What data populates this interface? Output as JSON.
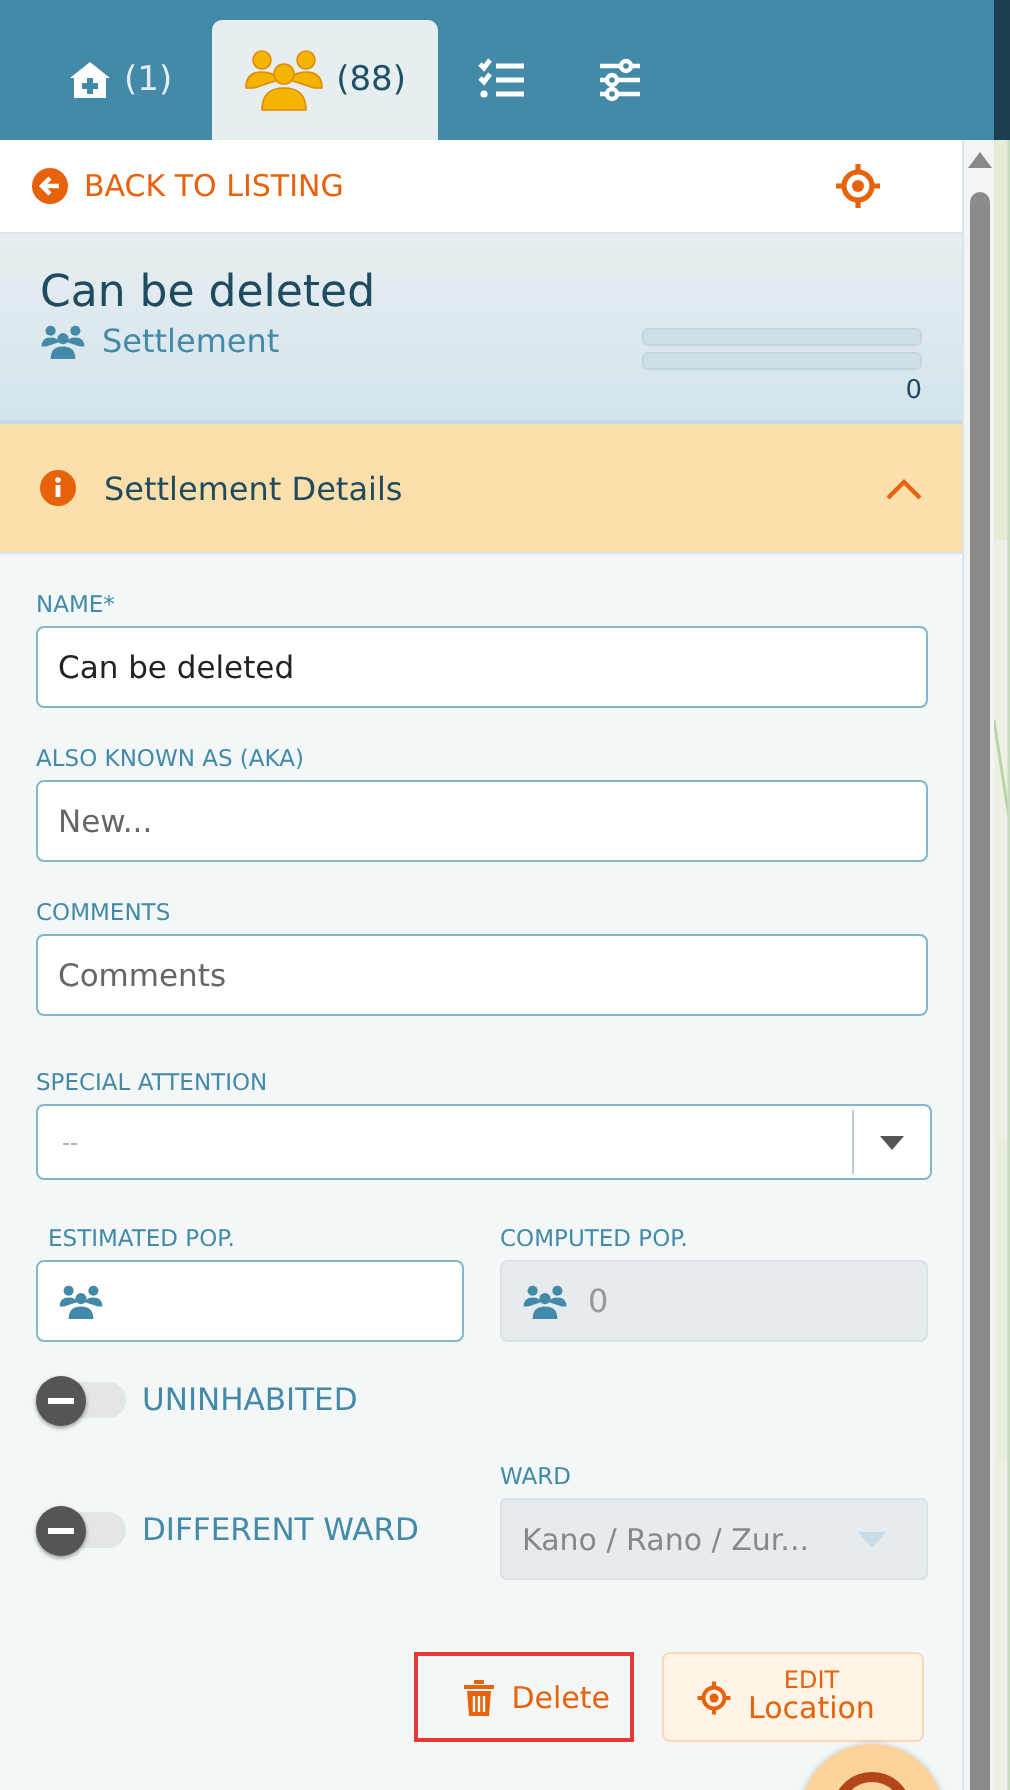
{
  "tabs": [
    {
      "kind": "home",
      "label": "(1)",
      "selected": false
    },
    {
      "kind": "people",
      "label": "(88)",
      "selected": true
    },
    {
      "kind": "checklist",
      "selected": false
    },
    {
      "kind": "filters",
      "selected": false
    }
  ],
  "back_link": "BACK TO LISTING",
  "header": {
    "title": "Can be deleted",
    "type": "Settlement",
    "bars": [
      {
        "level": 0
      },
      {
        "level": 0
      }
    ],
    "count": "0"
  },
  "section": {
    "title": "Settlement Details",
    "expanded": true
  },
  "fields": [
    {
      "kind": "text",
      "label": "NAME*",
      "value": "Can be deleted"
    },
    {
      "kind": "text",
      "label": "ALSO KNOWN AS (AKA)",
      "placeholder": "New..."
    },
    {
      "kind": "text",
      "label": "COMMENTS",
      "placeholder": "Comments"
    },
    {
      "kind": "select",
      "label": "SPECIAL ATTENTION",
      "placeholder": "--"
    }
  ],
  "population": [
    {
      "label": "ESTIMATED POP.",
      "disabled": false
    },
    {
      "label": "COMPUTED POP.",
      "value": "0",
      "disabled": true
    }
  ],
  "uninhabited": {
    "label": "UNINHABITED",
    "on": false
  },
  "different_ward": {
    "label": "DIFFERENT WARD",
    "on": false
  },
  "ward": {
    "label": "WARD",
    "value": "Kano / Rano / Zur...",
    "disabled": true
  },
  "buttons": [
    {
      "kind": "delete",
      "label": "Delete",
      "outlined": true
    },
    {
      "kind": "location",
      "label_top": "EDIT",
      "label": "Location"
    }
  ]
}
